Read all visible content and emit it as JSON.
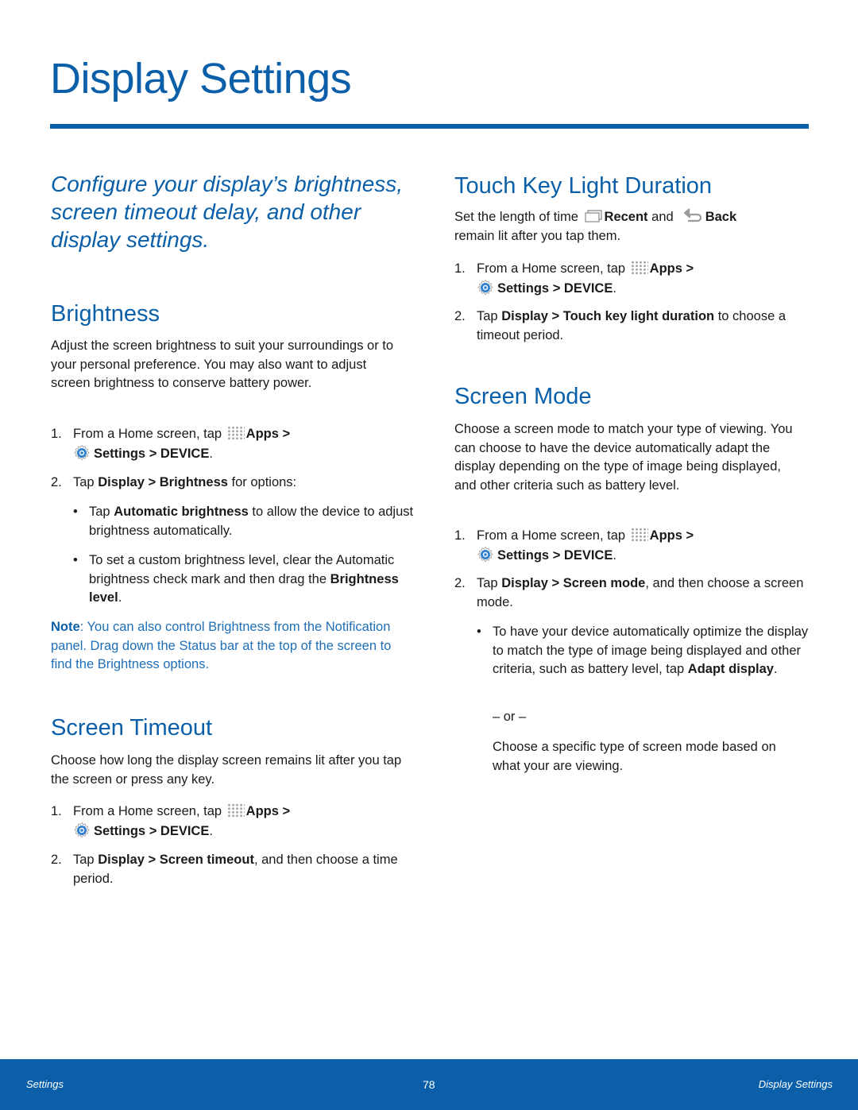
{
  "page": {
    "title": "Display Settings",
    "intro": "Configure your display’s brightness, screen timeout delay, and other display settings."
  },
  "common": {
    "step_from_home": "From a Home screen, tap",
    "apps": "Apps",
    "gt": ">",
    "settings": "Settings",
    "device": "DEVICE",
    "period": ".",
    "tap": "Tap",
    "display": "Display",
    "icons": {
      "apps": "apps-grid-icon",
      "settings": "settings-gear-icon",
      "recent": "recent-apps-icon",
      "back": "back-arrow-icon"
    }
  },
  "brightness": {
    "heading": "Brightness",
    "body": "Adjust the screen brightness to suit your surroundings or to your personal preference. You may also want to adjust screen brightness to conserve battery power.",
    "step1_num": "1.",
    "step2_num": "2.",
    "step2_target": "Brightness",
    "step2_suffix": "for options:",
    "bullet1_prefix": "Tap",
    "bullet1_bold": "Automatic brightness",
    "bullet1_suffix": "to allow the device to adjust brightness automatically.",
    "bullet2_prefix": "To set a custom brightness level, clear the Automatic brightness check mark and then drag the",
    "bullet2_bold": "Brightness level",
    "bullet2_suffix": ".",
    "note_label": "Note",
    "note_text": ": You can also control Brightness from the Notification panel. Drag down the Status bar at the top of the screen to find the Brightness options."
  },
  "screen_timeout": {
    "heading": "Screen Timeout",
    "body": "Choose how long the display screen remains lit after you tap the screen or press any key.",
    "step1_num": "1.",
    "step2_num": "2.",
    "step2_target": "Screen timeout",
    "step2_suffix": ", and then choose a time period."
  },
  "touch_key": {
    "heading": "Touch Key Light Duration",
    "body_prefix": "Set the length of time",
    "recent": "Recent",
    "and": "and",
    "back": "Back",
    "body_suffix": "remain lit after you tap them.",
    "step1_num": "1.",
    "step2_num": "2.",
    "step2_target": "Touch key light duration",
    "step2_suffix": "to choose a timeout period."
  },
  "screen_mode": {
    "heading": "Screen Mode",
    "body": "Choose a screen mode to match your type of viewing. You can choose to have the device automatically adapt the display depending on the type of image being displayed, and other criteria such as battery level.",
    "step1_num": "1.",
    "step2_num": "2.",
    "step2_target": "Screen mode",
    "step2_suffix": ", and then choose a screen mode.",
    "bullet1_prefix": "To have your device automatically optimize the display to match the type of image being displayed and other criteria, such as battery level, tap",
    "bullet1_bold": "Adapt display",
    "bullet1_suffix": ".",
    "or": "– or –",
    "alt": "Choose a specific type of screen mode based on what your are viewing."
  },
  "footer": {
    "left": "Settings",
    "page_number": "78",
    "right": "Display Settings"
  },
  "colors": {
    "accent": "#0a5fa8",
    "note": "#1e6fb8",
    "text": "#1a1a1a"
  }
}
